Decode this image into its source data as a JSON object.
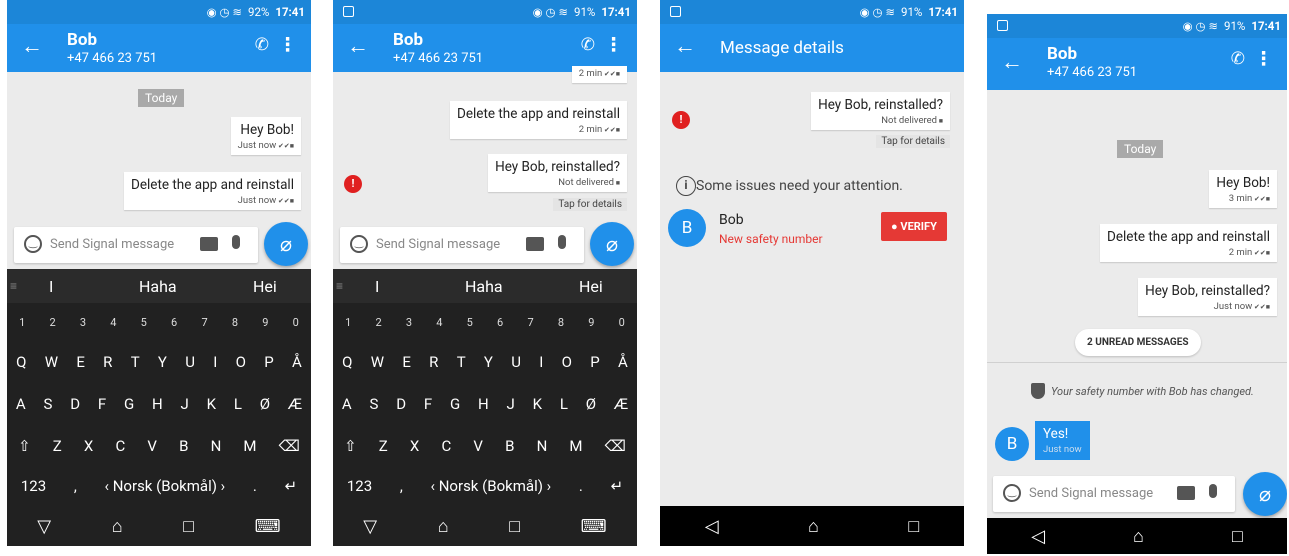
{
  "status": {
    "battery1": "92%",
    "battery2": "91%",
    "time": "17:41"
  },
  "contact": {
    "name": "Bob",
    "number": "+47 466 23 751"
  },
  "today_label": "Today",
  "messages": {
    "m1": "Hey Bob!",
    "m2": "Delete the app and reinstall",
    "m3": "Hey Bob, reinstalled?",
    "m4": "Yes!",
    "just_now": "Just now",
    "two_min": "2 min",
    "three_min": "3 min",
    "not_delivered": "Not delivered",
    "tap_details": "Tap for details"
  },
  "compose_placeholder": "Send Signal message",
  "keyboard": {
    "suggestions": [
      "I",
      "Haha",
      "Hei"
    ],
    "numbers": [
      "1",
      "2",
      "3",
      "4",
      "5",
      "6",
      "7",
      "8",
      "9",
      "0"
    ],
    "row1": [
      "Q",
      "W",
      "E",
      "R",
      "T",
      "Y",
      "U",
      "I",
      "O",
      "P",
      "Å"
    ],
    "row2": [
      "A",
      "S",
      "D",
      "F",
      "G",
      "H",
      "J",
      "K",
      "L",
      "Ø",
      "Æ"
    ],
    "row3": [
      "⇧",
      "Z",
      "X",
      "C",
      "V",
      "B",
      "N",
      "M",
      "⌫"
    ],
    "sym": "123",
    "lang": "‹ Norsk (Bokmål) ›"
  },
  "details": {
    "title": "Message details",
    "issues": "Some issues need your attention.",
    "new_safety": "New safety number",
    "verify": "VERIFY"
  },
  "panel4": {
    "unread": "2 UNREAD MESSAGES",
    "safety_changed": "Your safety number with Bob has changed."
  },
  "avatar_letter": "B",
  "colors": {
    "accent": "#2090ea",
    "statusbar": "#1c86d8",
    "error": "#e53935"
  }
}
